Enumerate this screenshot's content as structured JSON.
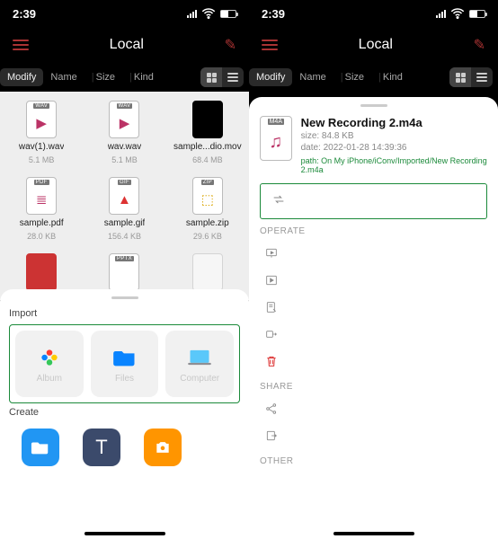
{
  "statusbar": {
    "time": "2:39"
  },
  "nav": {
    "title": "Local"
  },
  "filter": {
    "modify": "Modify",
    "name": "Name",
    "size": "Size",
    "kind": "Kind"
  },
  "grid": {
    "items": [
      {
        "tag": "WAV",
        "glyph": "▶",
        "name": "wav(1).wav",
        "size": "5.1 MB"
      },
      {
        "tag": "WAV",
        "glyph": "▶",
        "name": "wav.wav",
        "size": "5.1 MB"
      },
      {
        "tag": "",
        "glyph": "",
        "name": "sample...dio.mov",
        "size": "68.4 MB",
        "dark": true
      },
      {
        "tag": "PDF",
        "glyph": "≣",
        "name": "sample.pdf",
        "size": "28.0 KB"
      },
      {
        "tag": "GIF",
        "glyph": "▲",
        "name": "sample.gif",
        "size": "156.4 KB"
      },
      {
        "tag": "ZIP",
        "glyph": "⬚",
        "name": "sample.zip",
        "size": "29.6 KB"
      },
      {
        "tag": "",
        "glyph": "",
        "name": "",
        "size": ""
      },
      {
        "tag": "PPTX",
        "glyph": "",
        "name": "",
        "size": ""
      },
      {
        "tag": "",
        "glyph": "",
        "name": "",
        "size": ""
      }
    ]
  },
  "import": {
    "section": "Import",
    "options": [
      {
        "label": "Album",
        "glyph": "✿",
        "color": "#ff3b30"
      },
      {
        "label": "Files",
        "glyph": "📁",
        "color": "#0a84ff"
      },
      {
        "label": "Computer",
        "glyph": "💻",
        "color": "#5ac8fa"
      }
    ]
  },
  "create": {
    "section": "Create"
  },
  "detail": {
    "tag": "M4A",
    "title": "New Recording 2.m4a",
    "size": "size: 84.8 KB",
    "date": "date: 2022-01-28 14:39:36",
    "path": "path: On My iPhone/iConv/Imported/New Recording 2.m4a",
    "sections": {
      "operate": "OPERATE",
      "share": "SHARE",
      "other": "OTHER"
    }
  }
}
